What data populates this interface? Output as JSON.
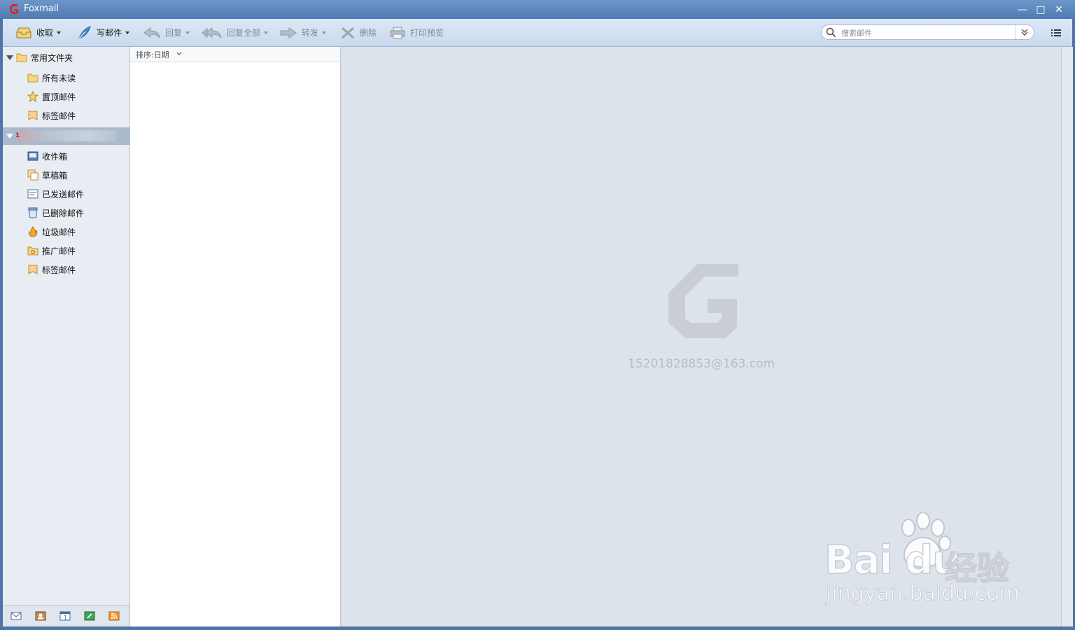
{
  "window": {
    "title": "Foxmail",
    "minimize_label": "—",
    "maximize_label": "□",
    "close_label": "✕"
  },
  "toolbar": {
    "receive_label": "收取",
    "compose_label": "写邮件",
    "reply_label": "回复",
    "reply_all_label": "回复全部",
    "forward_label": "转发",
    "delete_label": "删除",
    "print_preview_label": "打印预览"
  },
  "search": {
    "placeholder": "搜索邮件"
  },
  "sidebar": {
    "common_folders": {
      "label": "常用文件夹",
      "items": [
        {
          "label": "所有未读",
          "icon": "folder-icon"
        },
        {
          "label": "置顶邮件",
          "icon": "star-icon"
        },
        {
          "label": "标签邮件",
          "icon": "tag-icon"
        }
      ]
    },
    "account": {
      "label_fragment": "1",
      "items": [
        {
          "label": "收件箱",
          "icon": "inbox-icon"
        },
        {
          "label": "草稿箱",
          "icon": "drafts-icon"
        },
        {
          "label": "已发送邮件",
          "icon": "sent-icon"
        },
        {
          "label": "已删除邮件",
          "icon": "trash-icon"
        },
        {
          "label": "垃圾邮件",
          "icon": "spam-icon"
        },
        {
          "label": "推广邮件",
          "icon": "promo-icon"
        },
        {
          "label": "标签邮件",
          "icon": "tag-icon"
        }
      ]
    },
    "bottom_icons": [
      "mail-icon",
      "contacts-icon",
      "calendar-icon",
      "notes-icon",
      "rss-icon"
    ]
  },
  "maillist": {
    "sort_label": "排序:日期"
  },
  "preview": {
    "account_email": "15201828853@163.com"
  },
  "watermark": {
    "brand_text": "Bai du",
    "brand_cn": "经验",
    "url": "jingyan.baidu.com"
  },
  "colors": {
    "titlebar": "#5a82b9",
    "toolbar": "#d3e1f2",
    "sidebar": "#e8edf3",
    "preview": "#dde3ea",
    "account_row": "#aab9cb"
  }
}
